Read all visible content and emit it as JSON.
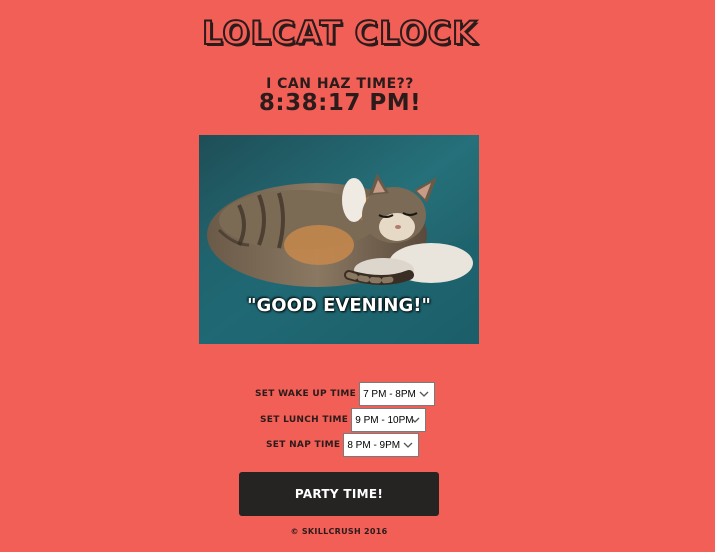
{
  "page": {
    "title": "Lolcat Clock",
    "subtitle": "I can haz time??",
    "time": "8:38:17 PM!"
  },
  "image": {
    "caption": "\"GOOD EVENING!\"",
    "description_icon": "sleeping-cat-photo"
  },
  "controls": {
    "wake": {
      "label": "Set wake up time",
      "value": "7 PM - 8PM"
    },
    "lunch": {
      "label": "Set lunch time",
      "value": "9 PM - 10PM"
    },
    "nap": {
      "label": "Set nap time",
      "value": "8 PM - 9PM"
    }
  },
  "button": {
    "label": "Party Time!"
  },
  "footer": {
    "text": "© Skillcrush 2016"
  },
  "colors": {
    "background": "#f15f57",
    "button": "#262323",
    "text": "#2b1b1b"
  }
}
